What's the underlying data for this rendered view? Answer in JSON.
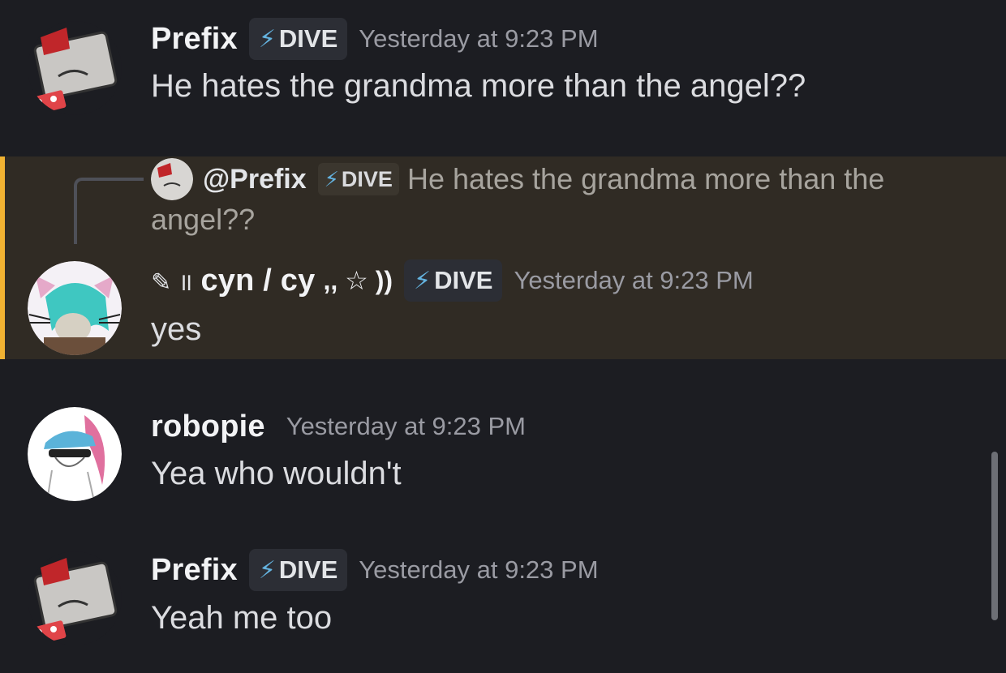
{
  "messages": [
    {
      "username": "Prefix",
      "tag": "DIVE",
      "timestamp": "Yesterday at 9:23 PM",
      "text": "He hates the grandma more than the angel??"
    },
    {
      "reply": {
        "mention": "@Prefix",
        "tag": "DIVE",
        "text_line1": "He hates the grandma more than the",
        "text_line2": "angel??"
      },
      "username_prefix": "✎ ॥",
      "username": "cyn / cy",
      "username_suffix": ",, ☆ ))",
      "tag": "DIVE",
      "timestamp": "Yesterday at 9:23 PM",
      "text": "yes"
    },
    {
      "username": "robopie",
      "timestamp": "Yesterday at 9:23 PM",
      "text": "Yea who wouldn't"
    },
    {
      "username": "Prefix",
      "tag": "DIVE",
      "timestamp": "Yesterday at 9:23 PM",
      "text": "Yeah me too"
    }
  ],
  "icons": {
    "tag_icon": "lightning-bolt-icon",
    "avatar_prefix": "tv-sticker-avatar",
    "avatar_cyn": "cat-ear-avatar",
    "avatar_robopie": "cap-avatar"
  },
  "colors": {
    "background": "#1c1d22",
    "highlight": "#302b24",
    "highlight_bar": "#f0b232",
    "tag_bolt": "#64b3e0"
  }
}
